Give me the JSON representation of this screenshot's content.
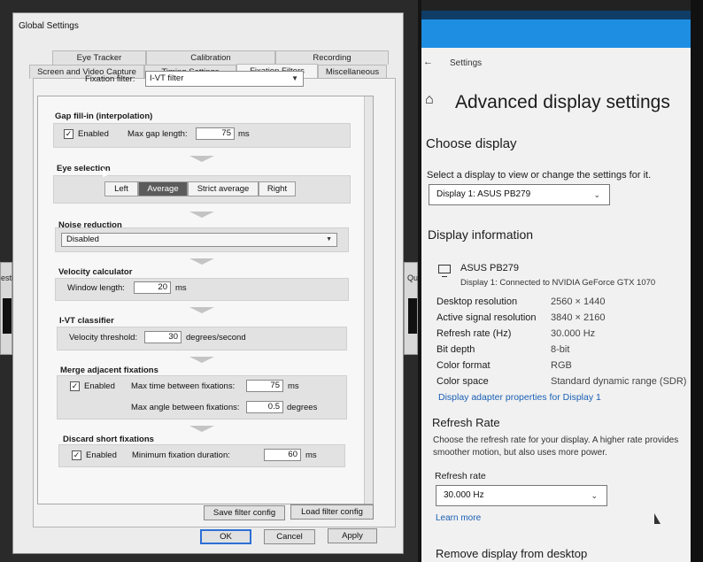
{
  "left_photo": {
    "window_title": "Global Settings",
    "bg_left_label": "estio",
    "bg_right_label": "Qu",
    "tabs": [
      {
        "label": "Eye Tracker"
      },
      {
        "label": "Calibration"
      },
      {
        "label": "Recording"
      },
      {
        "label": "Screen and Video Capture"
      },
      {
        "label": "Timing Settings"
      },
      {
        "label": "Fixation Filters",
        "active": true
      },
      {
        "label": "Miscellaneous"
      }
    ],
    "fixation_filter": {
      "label": "Fixation filter:",
      "value": "I-VT filter"
    },
    "gap_fill": {
      "title": "Gap fill-in (interpolation)",
      "enabled_label": "Enabled",
      "enabled": true,
      "max_gap_label": "Max gap length:",
      "max_gap_value": "75",
      "unit": "ms"
    },
    "eye_selection": {
      "title": "Eye selection",
      "options": [
        "Left",
        "Average",
        "Strict average",
        "Right"
      ],
      "selected": "Average"
    },
    "noise_reduction": {
      "title": "Noise reduction",
      "value": "Disabled"
    },
    "velocity_calculator": {
      "title": "Velocity calculator",
      "window_label": "Window length:",
      "window_value": "20",
      "unit": "ms"
    },
    "ivt_classifier": {
      "title": "I-VT classifier",
      "threshold_label": "Velocity threshold:",
      "threshold_value": "30",
      "unit": "degrees/second"
    },
    "merge": {
      "title": "Merge adjacent fixations",
      "enabled_label": "Enabled",
      "enabled": true,
      "max_time_label": "Max time between fixations:",
      "max_time_value": "75",
      "max_time_unit": "ms",
      "max_angle_label": "Max angle between fixations:",
      "max_angle_value": "0.5",
      "max_angle_unit": "degrees"
    },
    "discard": {
      "title": "Discard short fixations",
      "enabled_label": "Enabled",
      "enabled": true,
      "min_label": "Minimum fixation duration:",
      "min_value": "60",
      "unit": "ms"
    },
    "buttons": {
      "save_filter": "Save filter config",
      "load_filter": "Load filter config",
      "ok": "OK",
      "cancel": "Cancel",
      "apply": "Apply"
    }
  },
  "right_photo": {
    "back_label": "Settings",
    "page_title": "Advanced display settings",
    "choose_display": {
      "heading": "Choose display",
      "prompt": "Select a display to view or change the settings for it.",
      "selected": "Display 1: ASUS PB279"
    },
    "display_information": {
      "heading": "Display information",
      "monitor_name": "ASUS PB279",
      "monitor_sub": "Display 1: Connected to NVIDIA GeForce GTX 1070",
      "rows": [
        {
          "label": "Desktop resolution",
          "value": "2560 × 1440"
        },
        {
          "label": "Active signal resolution",
          "value": "3840 × 2160"
        },
        {
          "label": "Refresh rate (Hz)",
          "value": "30.000 Hz"
        },
        {
          "label": "Bit depth",
          "value": "8-bit"
        },
        {
          "label": "Color format",
          "value": "RGB"
        },
        {
          "label": "Color space",
          "value": "Standard dynamic range (SDR)"
        }
      ],
      "adapter_link": "Display adapter properties for Display 1"
    },
    "refresh_rate": {
      "heading": "Refresh Rate",
      "desc_line1": "Choose the refresh rate for your display. A higher rate provides",
      "desc_line2": "smoother motion, but also uses more power.",
      "field_label": "Refresh rate",
      "selected": "30.000 Hz",
      "learn_more": "Learn more"
    },
    "remove_display": {
      "heading": "Remove display from desktop"
    }
  }
}
